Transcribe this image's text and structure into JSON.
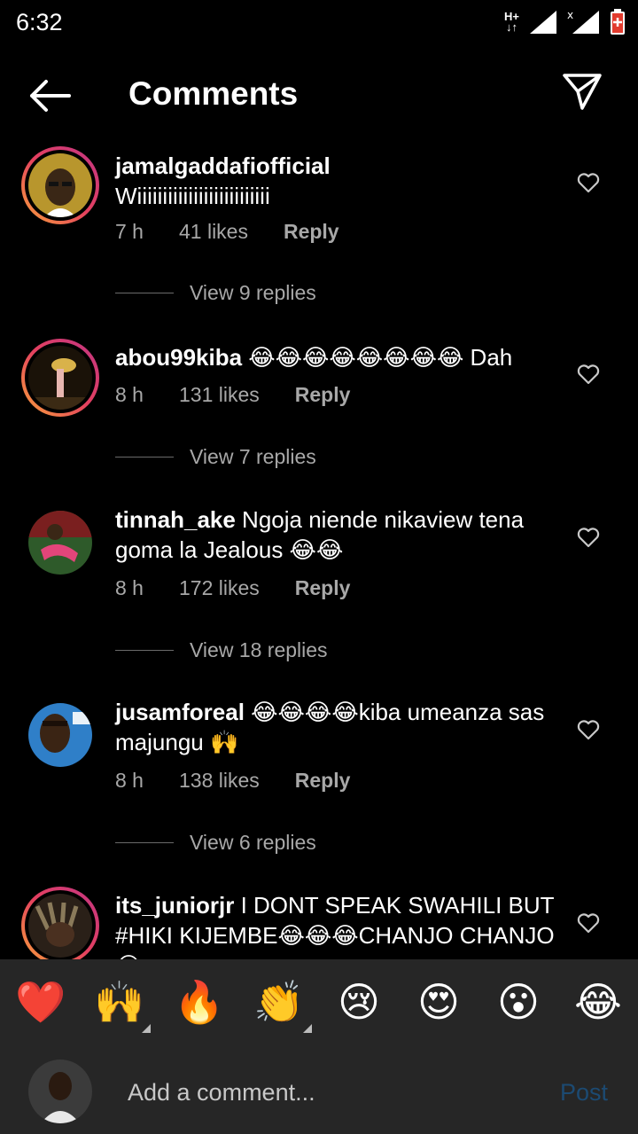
{
  "status": {
    "time": "6:32",
    "network": "H+"
  },
  "header": {
    "title": "Comments"
  },
  "comments": [
    {
      "username": "jamalgaddafiofficial",
      "text": "Wiiiiiiiiiiiiiiiiiiiiiiiiii",
      "time": "7 h",
      "likes": "41 likes",
      "reply": "Reply",
      "view_replies": "View 9 replies"
    },
    {
      "username": "abou99kiba",
      "text": " 😂😂😂😂😂😂😂😂 Dah",
      "time": "8 h",
      "likes": "131 likes",
      "reply": "Reply",
      "view_replies": "View 7 replies"
    },
    {
      "username": "tinnah_ake",
      "text": " Ngoja niende nikaview tena goma la Jealous 😂😂",
      "time": "8 h",
      "likes": "172 likes",
      "reply": "Reply",
      "view_replies": "View 18 replies"
    },
    {
      "username": "jusamforeal",
      "text": " 😂😂😂😂kiba umeanza sas majungu 🙌",
      "time": "8 h",
      "likes": "138 likes",
      "reply": "Reply",
      "view_replies": "View 6 replies"
    },
    {
      "username": "its_juniorjr",
      "text": " I DONT SPEAK SWAHILI BUT #HIKI KIJEMBE😂😂😂CHANJO CHANJO😂"
    }
  ],
  "reactions": [
    "❤️",
    "🙌",
    "🔥",
    "👏",
    "😢",
    "😍",
    "😮",
    "😂"
  ],
  "composer": {
    "placeholder": "Add a comment...",
    "post_label": "Post"
  },
  "colors": {
    "background": "#000000",
    "meta_text": "#a8a8a8",
    "post_disabled": "#1c4a72",
    "composer_bg": "#262626"
  }
}
